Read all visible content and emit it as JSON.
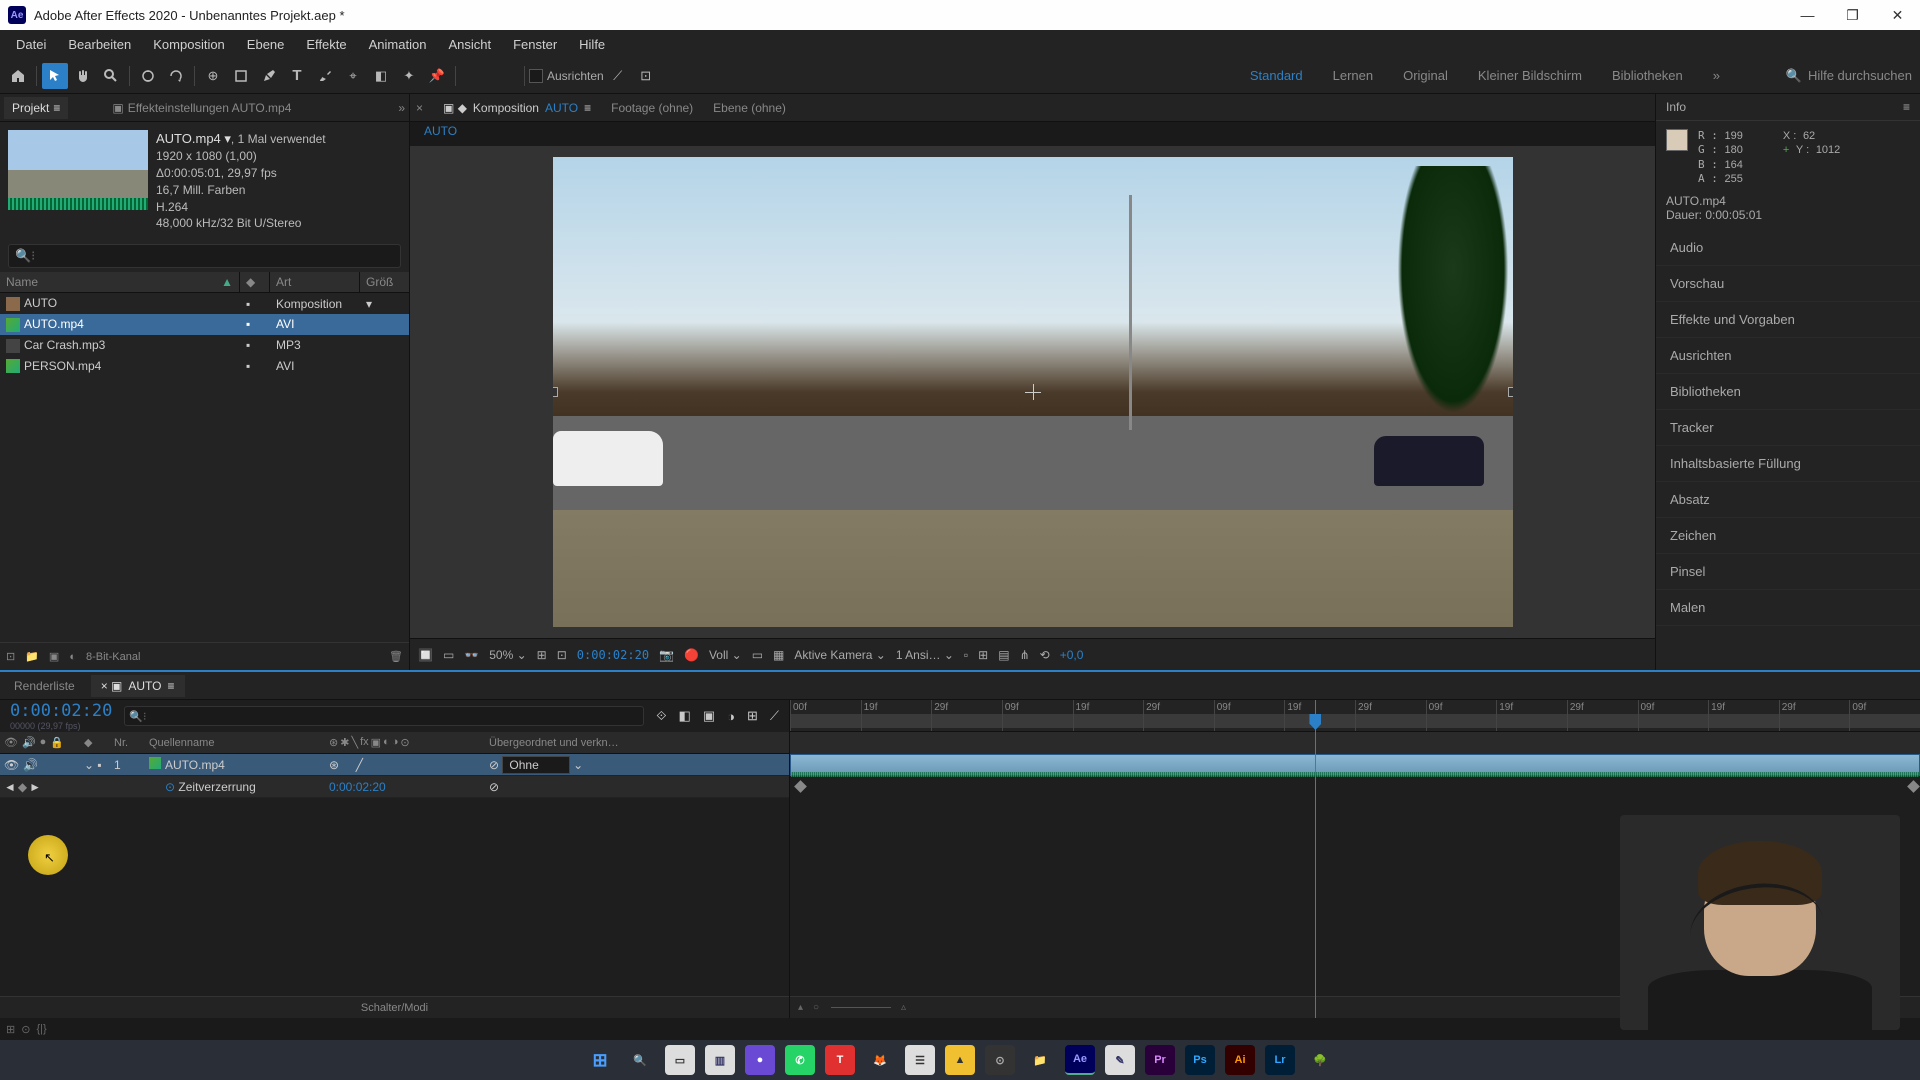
{
  "titlebar": {
    "app": "Ae",
    "title": "Adobe After Effects 2020 - Unbenanntes Projekt.aep *"
  },
  "menubar": [
    "Datei",
    "Bearbeiten",
    "Komposition",
    "Ebene",
    "Effekte",
    "Animation",
    "Ansicht",
    "Fenster",
    "Hilfe"
  ],
  "toolbar": {
    "snap_label": "Ausrichten",
    "workspaces": [
      "Standard",
      "Lernen",
      "Original",
      "Kleiner Bildschirm",
      "Bibliotheken"
    ],
    "active_workspace": "Standard",
    "search_placeholder": "Hilfe durchsuchen"
  },
  "project": {
    "tab_project": "Projekt",
    "tab_effectcontrols": "Effekteinstellungen  AUTO.mp4",
    "selected_name": "AUTO.mp4 ▾",
    "selected_usage": ", 1 Mal verwendet",
    "meta": [
      "1920 x 1080 (1,00)",
      "Δ0:00:05:01, 29,97 fps",
      "16,7 Mill. Farben",
      "H.264",
      "48,000 kHz/32 Bit U/Stereo"
    ],
    "cols": {
      "name": "Name",
      "type": "Art",
      "size": "Größ"
    },
    "items": [
      {
        "name": "AUTO",
        "type": "Komposition",
        "kind": "comp"
      },
      {
        "name": "AUTO.mp4",
        "type": "AVI",
        "kind": "avi",
        "selected": true
      },
      {
        "name": "Car Crash.mp3",
        "type": "MP3",
        "kind": "mp3"
      },
      {
        "name": "PERSON.mp4",
        "type": "AVI",
        "kind": "avi"
      }
    ],
    "footer_mode": "8-Bit-Kanal"
  },
  "viewer": {
    "tab_comp_prefix": "Komposition",
    "tab_comp_name": "AUTO",
    "tab_footage": "Footage  (ohne)",
    "tab_layer": "Ebene  (ohne)",
    "breadcrumb": "AUTO",
    "zoom": "50%",
    "timecode": "0:00:02:20",
    "resolution": "Voll",
    "camera": "Aktive Kamera",
    "views": "1 Ansi…",
    "exposure": "+0,0"
  },
  "info": {
    "label": "Info",
    "R": "199",
    "G": "180",
    "B": "164",
    "A": "255",
    "X_label": "X :",
    "X": "62",
    "Y_label": "Y :",
    "Y": "1012",
    "layer": "AUTO.mp4",
    "duration_label": "Dauer:",
    "duration": "0:00:05:01"
  },
  "right_panels": [
    "Audio",
    "Vorschau",
    "Effekte und Vorgaben",
    "Ausrichten",
    "Bibliotheken",
    "Tracker",
    "Inhaltsbasierte Füllung",
    "Absatz",
    "Zeichen",
    "Pinsel",
    "Malen"
  ],
  "timeline": {
    "tab_renderqueue": "Renderliste",
    "tab_comp": "AUTO",
    "timecode": "0:00:02:20",
    "fps_hint": "00000 (29,97 fps)",
    "col_nr": "Nr.",
    "col_source": "Quellenname",
    "col_parent": "Übergeordnet und verkn…",
    "layer_nr": "1",
    "layer_name": "AUTO.mp4",
    "layer_parent": "Ohne",
    "prop_name": "Zeitverzerrung",
    "prop_value": "0:00:02:20",
    "ruler_ticks": [
      "00f",
      "19f",
      "29f",
      "09f",
      "19f",
      "29f",
      "09f",
      "19f",
      "29f",
      "09f",
      "19f",
      "29f",
      "09f",
      "19f",
      "29f",
      "09f"
    ],
    "footer": "Schalter/Modi"
  },
  "taskbar_apps": [
    {
      "label": "⊞",
      "bg": "#3a6ad4",
      "fg": "#fff"
    },
    {
      "label": "🔍",
      "bg": "transparent",
      "fg": "#fff"
    },
    {
      "label": "▭",
      "bg": "#ddd",
      "fg": "#333"
    },
    {
      "label": "▥",
      "bg": "#ddd",
      "fg": "#336"
    },
    {
      "label": "●",
      "bg": "#6a4ad4",
      "fg": "#fff"
    },
    {
      "label": "✆",
      "bg": "#25d366",
      "fg": "#fff"
    },
    {
      "label": "T",
      "bg": "#e03030",
      "fg": "#fff"
    },
    {
      "label": "🦊",
      "bg": "#ff7030",
      "fg": "#fff"
    },
    {
      "label": "☰",
      "bg": "#ddd",
      "fg": "#333"
    },
    {
      "label": "▲",
      "bg": "#f0c030",
      "fg": "#333"
    },
    {
      "label": "⊙",
      "bg": "#333",
      "fg": "#aaa"
    },
    {
      "label": "📁",
      "bg": "#f0c050",
      "fg": "#333"
    },
    {
      "label": "Ae",
      "bg": "#00005b",
      "fg": "#9999ff"
    },
    {
      "label": "✎",
      "bg": "#ddd",
      "fg": "#336"
    },
    {
      "label": "Pr",
      "bg": "#2a003a",
      "fg": "#da88ff"
    },
    {
      "label": "Ps",
      "bg": "#001e36",
      "fg": "#31a8ff"
    },
    {
      "label": "Ai",
      "bg": "#330000",
      "fg": "#ff9a00"
    },
    {
      "label": "Lr",
      "bg": "#001e36",
      "fg": "#31a8ff"
    },
    {
      "label": "🌳",
      "bg": "#3a8a3a",
      "fg": "#fff"
    }
  ]
}
